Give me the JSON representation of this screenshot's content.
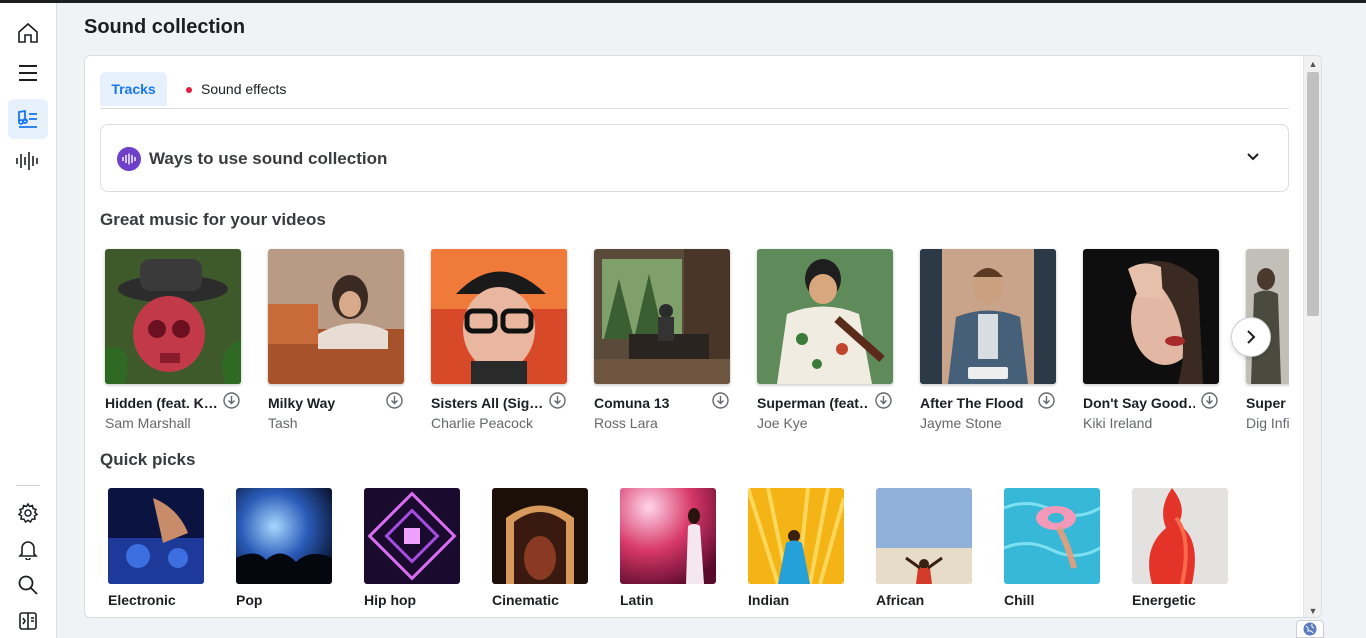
{
  "page": {
    "title": "Sound collection"
  },
  "rail": {
    "icons": [
      "home-icon",
      "menu-icon",
      "music-list-icon",
      "waveform-icon",
      "settings-icon",
      "bell-icon",
      "search-icon",
      "panel-toggle-icon"
    ],
    "active": "music-list-icon"
  },
  "tabs": [
    {
      "label": "Tracks",
      "selected": true
    },
    {
      "label": "Sound effects",
      "selected": false
    }
  ],
  "ways": {
    "title": "Ways to use sound collection"
  },
  "great_music": {
    "heading": "Great music for your videos",
    "tracks": [
      {
        "title": "Hidden (feat. K…",
        "artist": "Sam Marshall"
      },
      {
        "title": "Milky Way",
        "artist": "Tash"
      },
      {
        "title": "Sisters All (Sig…",
        "artist": "Charlie Peacock"
      },
      {
        "title": "Comuna 13",
        "artist": "Ross Lara"
      },
      {
        "title": "Superman (feat…",
        "artist": "Joe Kye"
      },
      {
        "title": "After The Flood",
        "artist": "Jayme Stone"
      },
      {
        "title": "Don't Say Good…",
        "artist": "Kiki Ireland"
      },
      {
        "title": "Super C",
        "artist": "Dig Infi"
      }
    ]
  },
  "quick_picks": {
    "heading": "Quick picks",
    "items": [
      {
        "label": "Electronic"
      },
      {
        "label": "Pop"
      },
      {
        "label": "Hip hop"
      },
      {
        "label": "Cinematic"
      },
      {
        "label": "Latin"
      },
      {
        "label": "Indian"
      },
      {
        "label": "African"
      },
      {
        "label": "Chill"
      },
      {
        "label": "Energetic"
      }
    ]
  },
  "colors": {
    "accent": "#1877f2",
    "tab_bg": "#e7f0fd",
    "notif_dot": "#e41e3f",
    "ways_icon": "#6e3fc9"
  }
}
